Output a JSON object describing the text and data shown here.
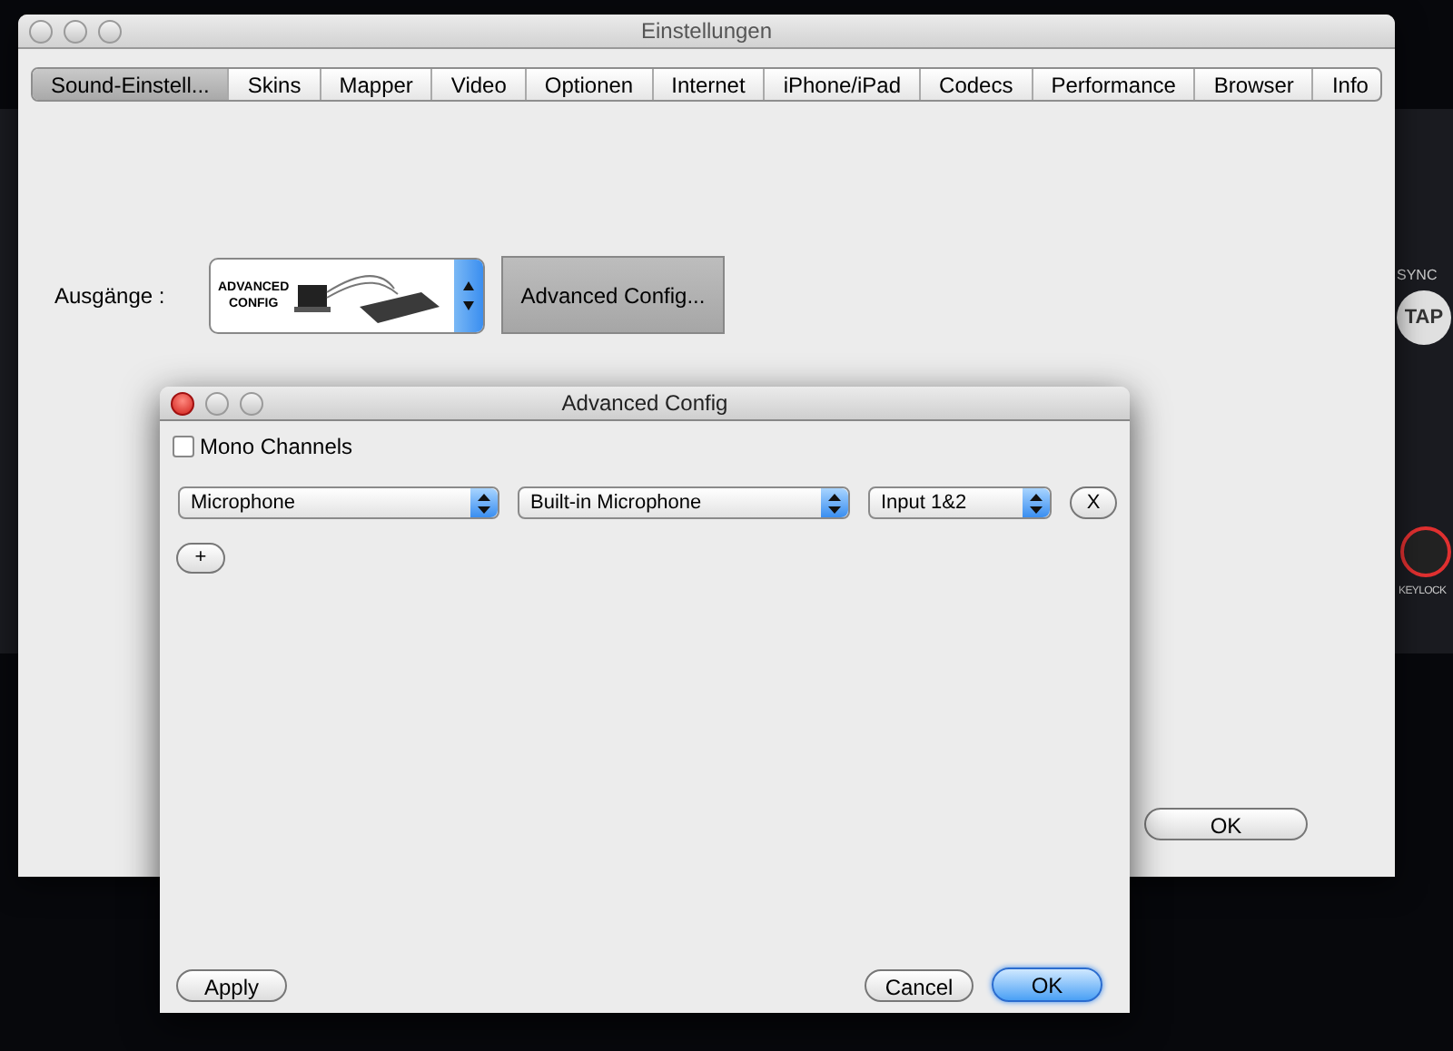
{
  "background_app": {
    "labels": [
      "SYNC",
      "TAP",
      "KEYLOCK"
    ]
  },
  "settings_window": {
    "title": "Einstellungen",
    "tabs": [
      {
        "label": "Sound-Einstell...",
        "selected": true
      },
      {
        "label": "Skins",
        "selected": false
      },
      {
        "label": "Mapper",
        "selected": false
      },
      {
        "label": "Video",
        "selected": false
      },
      {
        "label": "Optionen",
        "selected": false
      },
      {
        "label": "Internet",
        "selected": false
      },
      {
        "label": "iPhone/iPad",
        "selected": false
      },
      {
        "label": "Codecs",
        "selected": false
      },
      {
        "label": "Performance",
        "selected": false
      },
      {
        "label": "Browser",
        "selected": false
      },
      {
        "label": "Info",
        "selected": false
      }
    ],
    "outputs": {
      "label": "Ausgänge :",
      "preset_text": [
        "ADVANCED",
        "CONFIG"
      ],
      "config_button": "Advanced Config..."
    },
    "ok_button": "OK"
  },
  "dialog": {
    "title": "Advanced Config",
    "mono_channels": {
      "label": "Mono Channels",
      "checked": false
    },
    "channel_rows": [
      {
        "selects": [
          "Microphone",
          "Built-in Microphone",
          "Input 1&2"
        ],
        "remove_button": "X"
      }
    ],
    "add_button": "+",
    "apply_button": "Apply",
    "cancel_button": "Cancel",
    "ok_button": "OK"
  }
}
